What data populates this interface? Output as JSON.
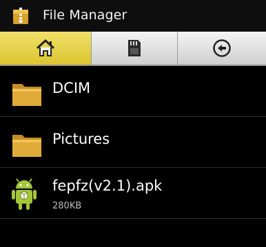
{
  "app": {
    "title": "File Manager",
    "icon": "folder-zip-icon"
  },
  "tabs": [
    {
      "name": "home",
      "icon": "home-icon",
      "active": true
    },
    {
      "name": "sdcard",
      "icon": "sd-card-icon",
      "active": false
    },
    {
      "name": "back",
      "icon": "back-arrow-icon",
      "active": false
    }
  ],
  "files": [
    {
      "name": "DCIM",
      "type": "folder",
      "icon": "folder-icon"
    },
    {
      "name": "Pictures",
      "type": "folder",
      "icon": "folder-icon"
    },
    {
      "name": "fepfz(v2.1).apk",
      "type": "apk",
      "size": "280KB",
      "icon": "android-icon"
    }
  ],
  "colors": {
    "accent_tab": "#dcc530",
    "folder": "#d9a531",
    "android_green": "#a4c639"
  }
}
